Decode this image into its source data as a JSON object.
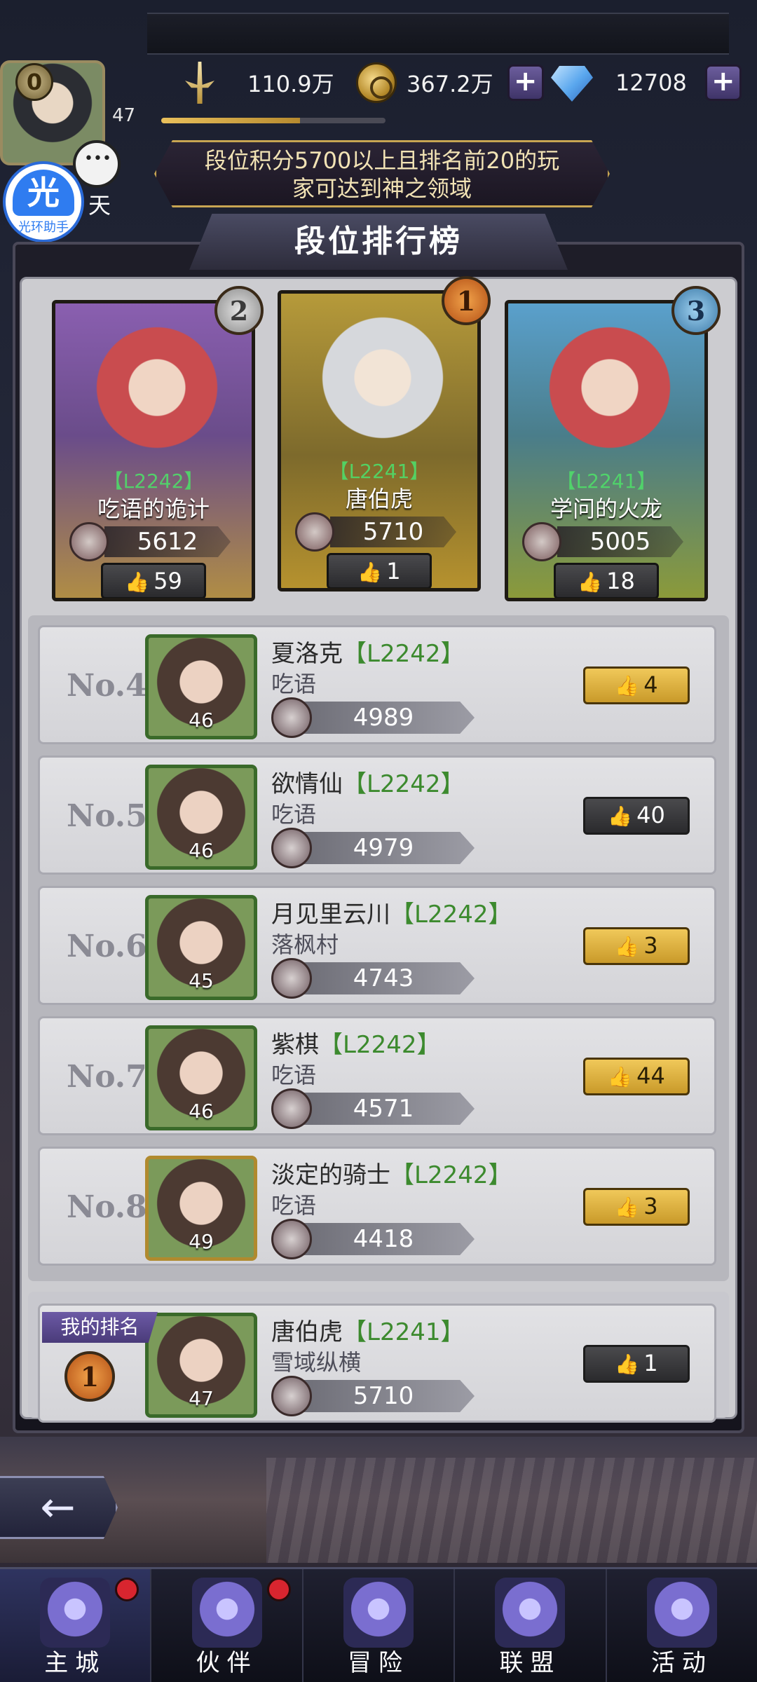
{
  "header": {
    "rank_badge": "0",
    "player_level": "47",
    "chat_label": "天",
    "assistant_badge_text": "光",
    "assistant_label": "光环助手",
    "resources": [
      {
        "name": "power",
        "icon": "sword-icon",
        "value": "110.9万"
      },
      {
        "name": "gold",
        "icon": "gold-coin-icon",
        "value": "367.2万"
      },
      {
        "name": "diamond",
        "icon": "diamond-icon",
        "value": "12708"
      }
    ],
    "exp_progress": 0.62
  },
  "banner": {
    "line1": "段位积分5700以上且排名前20的玩",
    "line2": "家可达到神之领域"
  },
  "title": "段位排行榜",
  "top3": [
    {
      "rank": "2",
      "level_tag": "【L2242】",
      "name": "吃语的诡计",
      "score": "5612",
      "likes": "59"
    },
    {
      "rank": "1",
      "level_tag": "【L2241】",
      "name": "唐伯虎",
      "score": "5710",
      "likes": "1"
    },
    {
      "rank": "3",
      "level_tag": "【L2241】",
      "name": "学问的火龙",
      "score": "5005",
      "likes": "18"
    }
  ],
  "rows": [
    {
      "no": "No.4",
      "name": "夏洛克",
      "level": "【L2242】",
      "guild": "吃语",
      "portrait_level": "46",
      "score": "4989",
      "likes": "4",
      "like_style": "gold"
    },
    {
      "no": "No.5",
      "name": "欲情仙",
      "level": "【L2242】",
      "guild": "吃语",
      "portrait_level": "46",
      "score": "4979",
      "likes": "40",
      "like_style": "dark"
    },
    {
      "no": "No.6",
      "name": "月见里云川",
      "level": "【L2242】",
      "guild": "落枫村",
      "portrait_level": "45",
      "score": "4743",
      "likes": "3",
      "like_style": "gold"
    },
    {
      "no": "No.7",
      "name": "紫棋",
      "level": "【L2242】",
      "guild": "吃语",
      "portrait_level": "46",
      "score": "4571",
      "likes": "44",
      "like_style": "gold"
    },
    {
      "no": "No.8",
      "name": "淡定的骑士",
      "level": "【L2242】",
      "guild": "吃语",
      "portrait_level": "49",
      "score": "4418",
      "likes": "3",
      "like_style": "gold"
    }
  ],
  "my_rank": {
    "tag": "我的排名",
    "rank": "1",
    "name": "唐伯虎",
    "level": "【L2241】",
    "guild": "雪域纵横",
    "portrait_level": "47",
    "score": "5710",
    "likes": "1"
  },
  "bottom_nav": [
    {
      "label": "主城",
      "icon": "castle-icon",
      "badge": true
    },
    {
      "label": "伙伴",
      "icon": "wizard-hat-icon",
      "badge": true
    },
    {
      "label": "冒险",
      "icon": "compass-star-icon",
      "badge": false
    },
    {
      "label": "联盟",
      "icon": "shield-icon",
      "badge": false
    },
    {
      "label": "活动",
      "icon": "cards-icon",
      "badge": false
    }
  ],
  "thumb_glyph": "👍"
}
